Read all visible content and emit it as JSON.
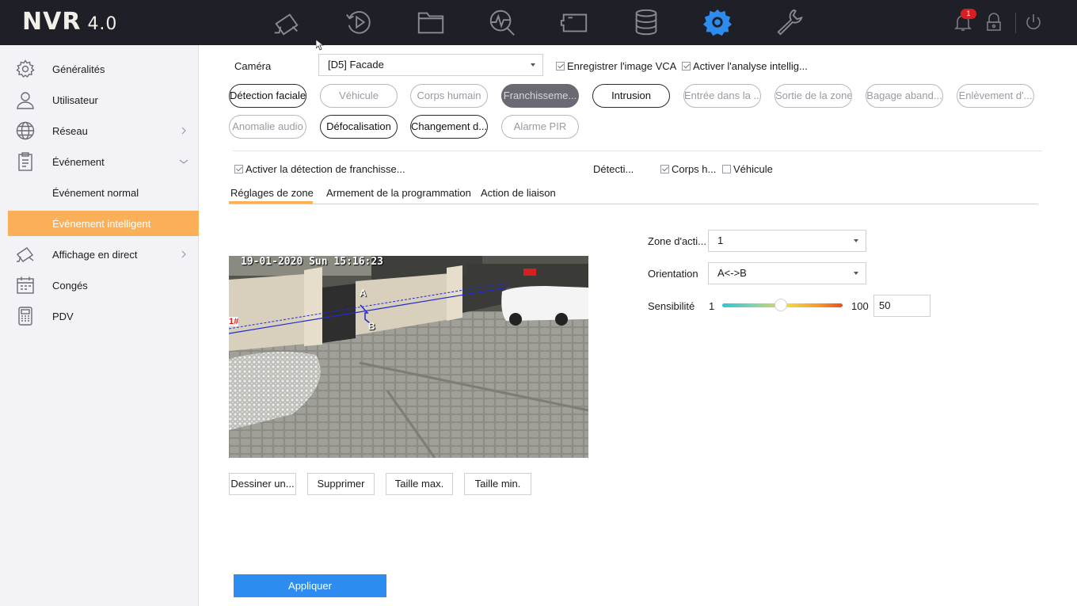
{
  "app": {
    "logo": "NVR",
    "version": "4.0"
  },
  "topbar": {
    "icons": [
      "camera-icon",
      "playback-icon",
      "folder-icon",
      "search-graph-icon",
      "video-icon",
      "storage-icon",
      "settings-icon",
      "wrench-icon"
    ],
    "active_icon": "settings-icon",
    "notification_count": "1"
  },
  "sidebar": {
    "items": [
      {
        "label": "Généralités",
        "icon": "gear-icon"
      },
      {
        "label": "Utilisateur",
        "icon": "user-icon"
      },
      {
        "label": "Réseau",
        "icon": "globe-icon"
      },
      {
        "label": "Événement",
        "icon": "clipboard-icon"
      },
      {
        "label": "Événement normal",
        "icon": ""
      },
      {
        "label": "Événement intelligent",
        "icon": ""
      },
      {
        "label": "Affichage en direct",
        "icon": "camera-icon"
      },
      {
        "label": "Congés",
        "icon": "calendar-icon"
      },
      {
        "label": "PDV",
        "icon": "pos-icon"
      }
    ],
    "active_item": "Événement intelligent",
    "accent": "#fbb057"
  },
  "main": {
    "camera_label": "Caméra",
    "camera_value": "[D5] Facade",
    "save_vca": "Enregistrer l'image VCA",
    "enable_analysis": "Activer l'analyse intellig...",
    "event_buttons_row1": [
      "Détection faciale",
      "Véhicule",
      "Corps humain",
      "Franchisseme...",
      "Intrusion",
      "Entrée dans la ...",
      "Sortie de la zone",
      "Bagage aband...",
      "Enlèvement d'..."
    ],
    "event_buttons_row2": [
      "Anomalie audio",
      "Défocalisation",
      "Changement d...",
      "Alarme PIR"
    ],
    "selected_event": "Franchisseme...",
    "enable_detection": "Activer la détection de franchisse...",
    "detection_label": "Détecti...",
    "target_human": "Corps h...",
    "target_vehicle": "Véhicule",
    "tabs": [
      "Réglages de zone",
      "Armement de la programmation",
      "Action de liaison"
    ],
    "active_tab": "Réglages de zone",
    "video": {
      "osd": "19-01-2020 Sun 15:16:23",
      "label_a": "A",
      "label_b": "B",
      "line_marker": "1#"
    },
    "draw_buttons": [
      "Dessiner un...",
      "Supprimer",
      "Taille max.",
      "Taille min."
    ],
    "zone_label": "Zone d'acti...",
    "zone_value": "1",
    "orientation_label": "Orientation",
    "orientation_value": "A<->B",
    "sensitivity_label": "Sensibilité",
    "sens_min": "1",
    "sens_max": "100",
    "sens_value": "50",
    "apply_label": "Appliquer",
    "apply_color": "#2d8cf0"
  }
}
